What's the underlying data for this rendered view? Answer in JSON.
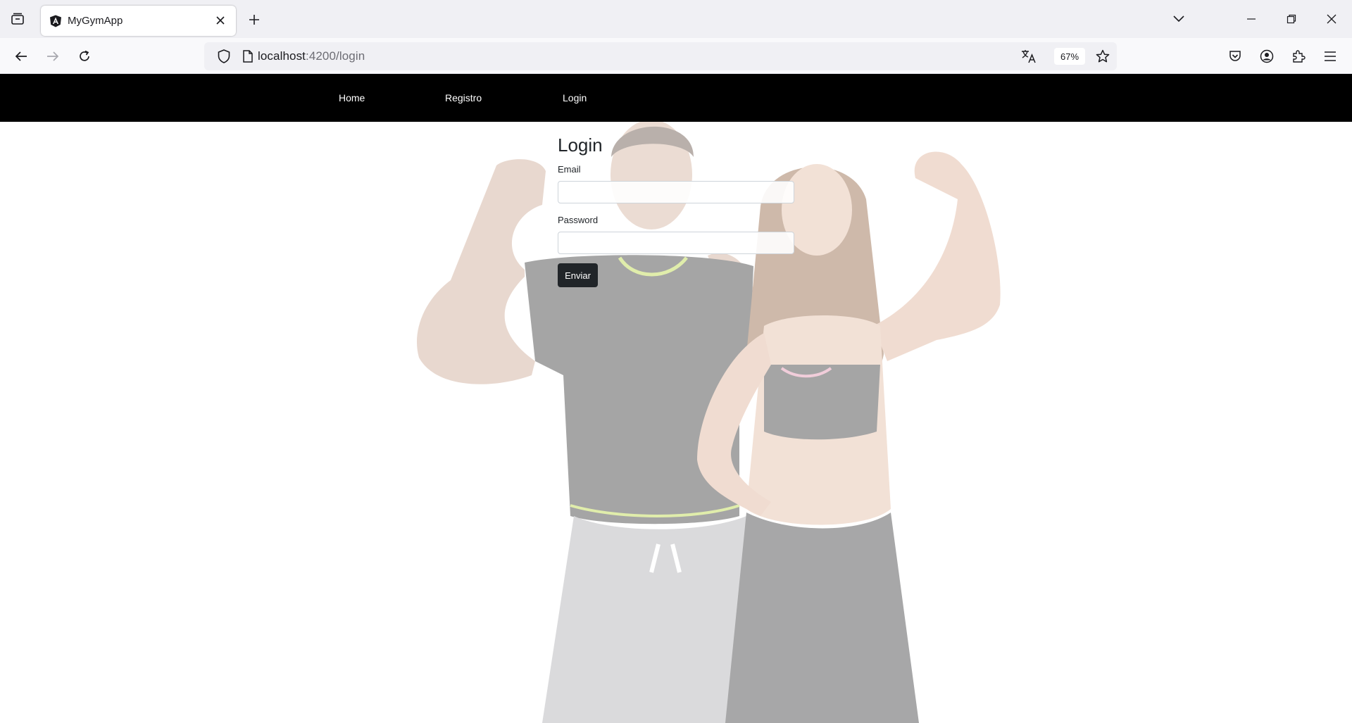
{
  "browser": {
    "tab": {
      "title": "MyGymApp"
    },
    "address": {
      "host": "localhost",
      "path": ":4200/login"
    },
    "zoom": "67%",
    "icons": {
      "tab_manager": "tab-manager-icon",
      "close_tab": "close-icon",
      "new_tab": "plus-icon",
      "list_tabs": "chevron-down-icon",
      "minimize": "minimize-icon",
      "restore": "restore-icon",
      "close_window": "close-icon",
      "back": "arrow-left-icon",
      "forward": "arrow-right-icon",
      "reload": "reload-icon",
      "shield": "shield-icon",
      "page": "page-icon",
      "translate": "translate-icon",
      "bookmark": "star-icon",
      "pocket": "pocket-icon",
      "account": "account-icon",
      "extensions": "puzzle-icon",
      "menu": "hamburger-menu-icon"
    }
  },
  "site": {
    "nav": {
      "home": "Home",
      "registro": "Registro",
      "login": "Login"
    },
    "login": {
      "title": "Login",
      "email_label": "Email",
      "email_value": "",
      "password_label": "Password",
      "password_value": "",
      "submit": "Enviar"
    },
    "colors": {
      "navbar": "#000000",
      "button": "#212529"
    }
  }
}
